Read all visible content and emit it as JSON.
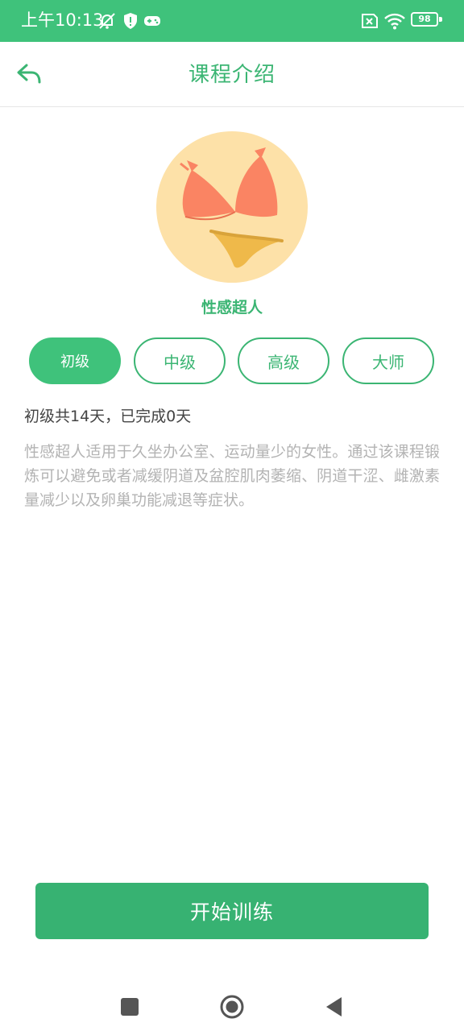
{
  "status_bar": {
    "time": "上午10:13",
    "battery": "98",
    "icons": [
      "silent-bell-icon",
      "shield-alert-icon",
      "gamepad-icon",
      "sim-off-icon",
      "wifi-icon",
      "battery-icon"
    ]
  },
  "header": {
    "title": "课程介绍",
    "back_icon": "back-arrow-icon"
  },
  "course": {
    "name": "性感超人",
    "image_icon": "bikini-icon",
    "levels": [
      {
        "label": "初级",
        "active": true
      },
      {
        "label": "中级",
        "active": false
      },
      {
        "label": "高级",
        "active": false
      },
      {
        "label": "大师",
        "active": false
      }
    ],
    "progress": "初级共14天，已完成0天",
    "description": "性感超人适用于久坐办公室、运动量少的女性。通过该课程锻炼可以避免或者减缓阴道及盆腔肌肉萎缩、阴道干涩、雌激素量减少以及卵巢功能减退等症状。"
  },
  "actions": {
    "start_label": "开始训练"
  },
  "nav": {
    "icons": [
      "recents-square-icon",
      "home-circle-icon",
      "back-triangle-icon"
    ]
  },
  "colors": {
    "status_bar": "#3fc27b",
    "accent": "#3bb573",
    "button": "#37b272",
    "avatar_bg": "#fde1a8",
    "bikini_top": "#fa8463",
    "bikini_bottom": "#efb94a"
  }
}
